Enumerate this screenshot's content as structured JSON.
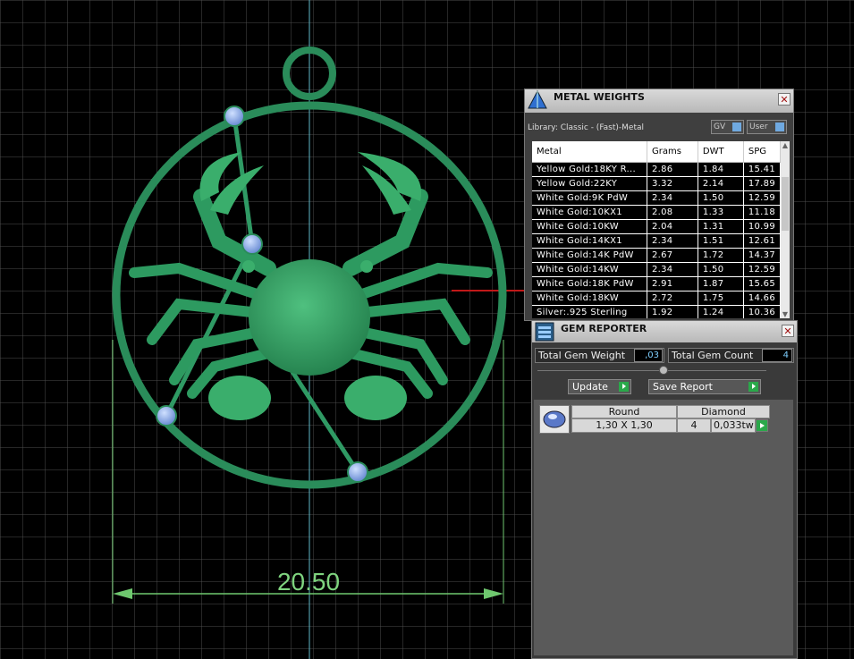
{
  "viewport": {
    "dimension_label": "20.50",
    "colors": {
      "background": "#000000",
      "grid": "#4a4a4a",
      "model": "#2f9a64",
      "gem": "#8ab3f0",
      "dimension": "#7fd47f"
    }
  },
  "metal_weights": {
    "title": "METAL WEIGHTS",
    "library": "Library: Classic - (Fast)-Metal",
    "toggle_gv": "GV",
    "toggle_user": "User",
    "columns": [
      "Metal",
      "Grams",
      "DWT",
      "SPG"
    ],
    "rows": [
      [
        "Yellow Gold:18KY R...",
        "2.86",
        "1.84",
        "15.41"
      ],
      [
        "Yellow Gold:22KY",
        "3.32",
        "2.14",
        "17.89"
      ],
      [
        "White Gold:9K PdW",
        "2.34",
        "1.50",
        "12.59"
      ],
      [
        "White Gold:10KX1",
        "2.08",
        "1.33",
        "11.18"
      ],
      [
        "White Gold:10KW",
        "2.04",
        "1.31",
        "10.99"
      ],
      [
        "White Gold:14KX1",
        "2.34",
        "1.51",
        "12.61"
      ],
      [
        "White Gold:14K PdW",
        "2.67",
        "1.72",
        "14.37"
      ],
      [
        "White Gold:14KW",
        "2.34",
        "1.50",
        "12.59"
      ],
      [
        "White Gold:18K PdW",
        "2.91",
        "1.87",
        "15.65"
      ],
      [
        "White Gold:18KW",
        "2.72",
        "1.75",
        "14.66"
      ],
      [
        "Silver:.925 Sterling",
        "1.92",
        "1.24",
        "10.36"
      ]
    ]
  },
  "gem_reporter": {
    "title": "GEM REPORTER",
    "total_gem_weight_label": "Total Gem Weight",
    "total_gem_weight_value": ",03",
    "total_gem_count_label": "Total Gem Count",
    "total_gem_count_value": "4",
    "update_label": "Update",
    "save_report_label": "Save Report",
    "gem": {
      "shape": "Round",
      "material": "Diamond",
      "size": "1,30 X 1,30",
      "count": "4",
      "weight": "0,033tw"
    }
  }
}
